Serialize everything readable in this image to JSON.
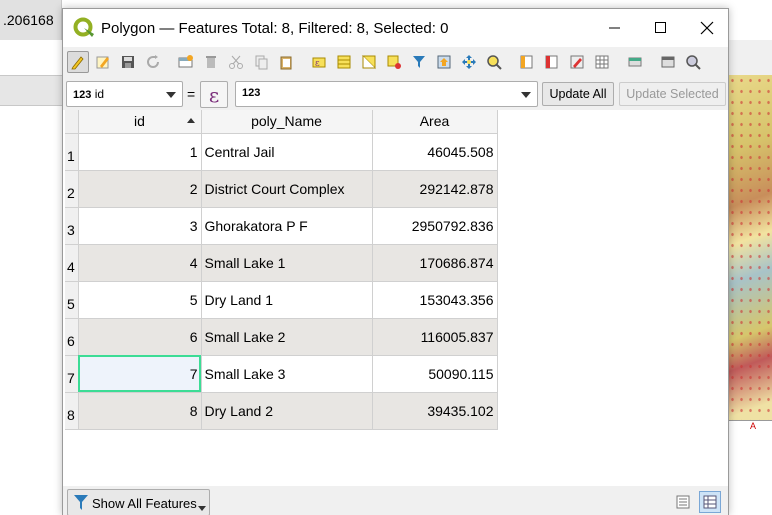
{
  "background": {
    "left_value": ".206168",
    "map_legend_letter": "A"
  },
  "window": {
    "title": "Polygon — Features Total: 8, Filtered: 8, Selected: 0"
  },
  "toolbar": {
    "icons": [
      "edit-pencil-icon",
      "multi-edit-icon",
      "save-edits-icon",
      "reload-icon",
      "add-feature-icon",
      "delete-feature-icon",
      "cut-icon",
      "copy-icon",
      "paste-icon",
      "expression-select-icon",
      "select-all-icon",
      "invert-selection-icon",
      "deselect-icon",
      "filter-icon",
      "move-to-top-icon",
      "pan-to-selected-icon",
      "zoom-to-selected-icon",
      "new-field-icon",
      "delete-field-icon",
      "field-calculator-icon",
      "conditional-format-icon",
      "actions-icon",
      "dock-icon",
      "help-icon"
    ]
  },
  "expression_bar": {
    "field_type": "123",
    "field_name": "id",
    "equals": "=",
    "epsilon": "ε",
    "expression_type": "123",
    "update_all_label": "Update All",
    "update_selected_label": "Update Selected"
  },
  "table": {
    "headers": [
      "id",
      "poly_Name",
      "Area"
    ],
    "rows": [
      {
        "rownum": "1",
        "id": "1",
        "name": "Central Jail",
        "area": "46045.508"
      },
      {
        "rownum": "2",
        "id": "2",
        "name": "District Court Complex",
        "area": "292142.878"
      },
      {
        "rownum": "3",
        "id": "3",
        "name": "Ghorakatora P F",
        "area": "2950792.836"
      },
      {
        "rownum": "4",
        "id": "4",
        "name": "Small Lake 1",
        "area": "170686.874"
      },
      {
        "rownum": "5",
        "id": "5",
        "name": "Dry Land 1",
        "area": "153043.356"
      },
      {
        "rownum": "6",
        "id": "6",
        "name": "Small Lake 2",
        "area": "116005.837"
      },
      {
        "rownum": "7",
        "id": "7",
        "name": "Small Lake 3",
        "area": "50090.115"
      },
      {
        "rownum": "8",
        "id": "8",
        "name": "Dry Land 2",
        "area": "39435.102"
      }
    ],
    "selected_row_index": 6
  },
  "statusbar": {
    "show_all_label": "Show All Features"
  },
  "colors": {
    "selection_outline": "#3cdc95",
    "alt_row": "#e8e6e3"
  }
}
